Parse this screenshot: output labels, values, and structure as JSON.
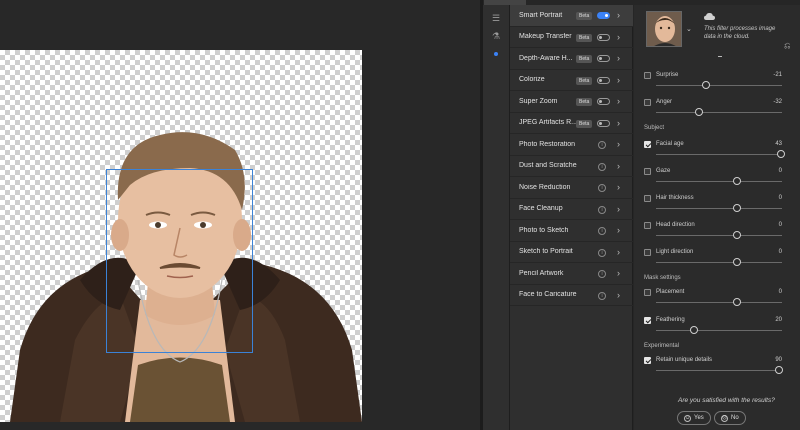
{
  "filters": [
    {
      "label": "Smart Portrait",
      "kind": "toggle",
      "beta": "Beta",
      "on": true,
      "active": true
    },
    {
      "label": "Makeup Transfer",
      "kind": "toggle",
      "beta": "Beta",
      "on": false
    },
    {
      "label": "Depth-Aware H...",
      "kind": "toggle",
      "beta": "Beta",
      "on": false
    },
    {
      "label": "Colorize",
      "kind": "toggle",
      "beta": "Beta",
      "on": false
    },
    {
      "label": "Super Zoom",
      "kind": "toggle",
      "beta": "Beta",
      "on": false
    },
    {
      "label": "JPEG Artifacts R...",
      "kind": "toggle",
      "beta": "Beta",
      "on": false
    },
    {
      "label": "Photo Restoration",
      "kind": "cloud"
    },
    {
      "label": "Dust and Scratches",
      "kind": "cloud"
    },
    {
      "label": "Noise Reduction",
      "kind": "cloud"
    },
    {
      "label": "Face Cleanup",
      "kind": "cloud"
    },
    {
      "label": "Photo to Sketch",
      "kind": "cloud"
    },
    {
      "label": "Sketch to Portrait",
      "kind": "cloud"
    },
    {
      "label": "Pencil Artwork",
      "kind": "cloud"
    },
    {
      "label": "Face to Caricature",
      "kind": "cloud"
    }
  ],
  "settings": {
    "cloud_note": "This filter processes image data in the cloud.",
    "sections": {
      "subject": "Subject",
      "mask": "Mask settings",
      "experimental": "Experimental"
    },
    "sliders": [
      {
        "label": "Surprise",
        "value": "-21",
        "checked": false,
        "level": 0.4
      },
      {
        "label": "Anger",
        "value": "-32",
        "checked": false,
        "level": 0.34
      },
      {
        "label": "Facial age",
        "value": "43",
        "checked": true,
        "level": 0.995
      },
      {
        "label": "Gaze",
        "value": "0",
        "checked": false,
        "level": 0.64
      },
      {
        "label": "Hair thickness",
        "value": "0",
        "checked": false,
        "level": 0.64
      },
      {
        "label": "Head direction",
        "value": "0",
        "checked": false,
        "level": 0.64
      },
      {
        "label": "Light direction",
        "value": "0",
        "checked": false,
        "level": 0.64
      },
      {
        "label": "Placement",
        "value": "0",
        "checked": false,
        "level": 0.64
      },
      {
        "label": "Feathering",
        "value": "20",
        "checked": true,
        "level": 0.3
      },
      {
        "label": "Retain unique details",
        "value": "90",
        "checked": true,
        "level": 0.98
      }
    ],
    "question": "Are you satisfied with the results?",
    "yes": "Yes",
    "no": "No"
  },
  "colors": {
    "accent": "#3b82f6",
    "face_box": "#3b82d6"
  }
}
